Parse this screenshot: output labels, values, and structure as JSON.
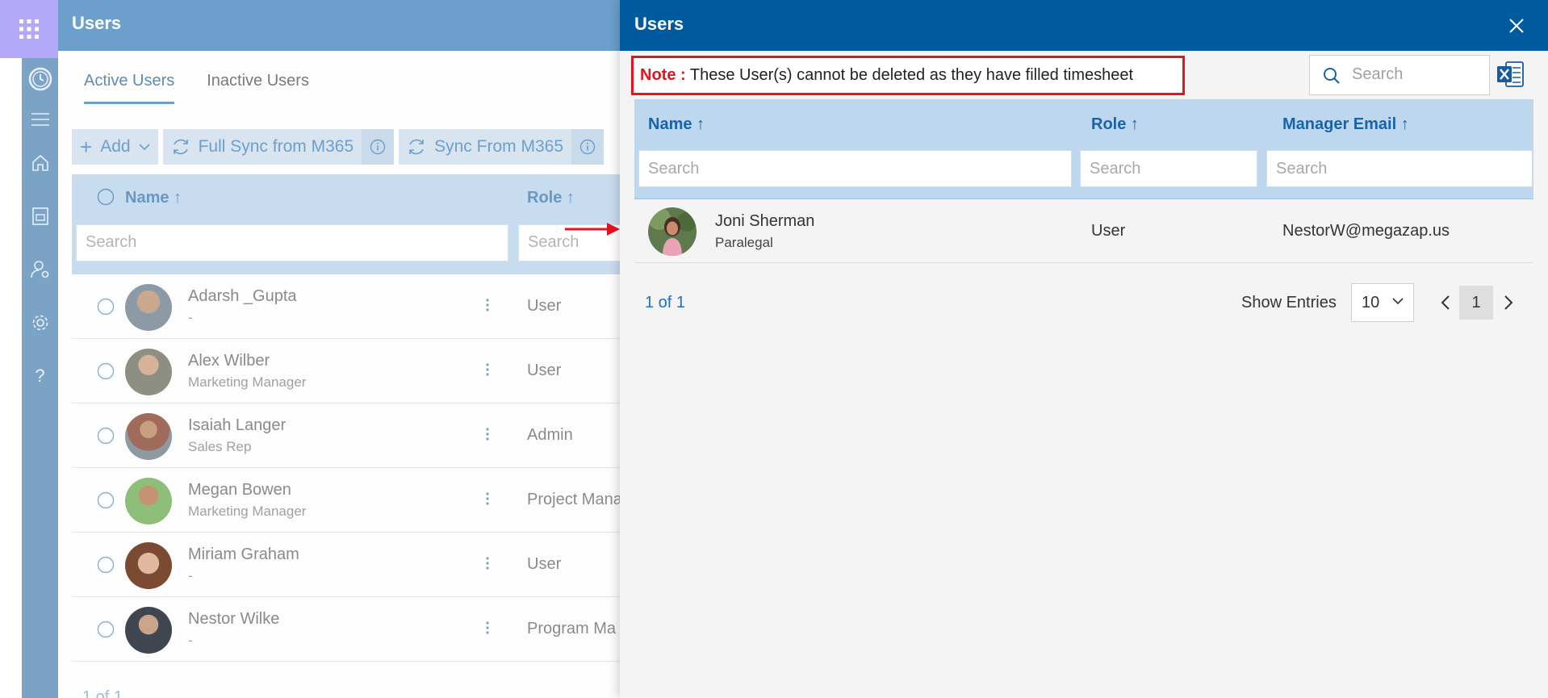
{
  "background": {
    "app_title": "Users",
    "tabs": [
      {
        "label": "Active Users",
        "active": true
      },
      {
        "label": "Inactive Users",
        "active": false
      }
    ],
    "toolbar": {
      "add_label": "Add",
      "full_sync_label": "Full Sync from M365",
      "sync_label": "Sync From M365"
    },
    "table": {
      "columns": {
        "name": "Name ↑",
        "role": "Role ↑"
      },
      "search_placeholder": "Search",
      "rows": [
        {
          "name": "Adarsh _Gupta",
          "subtitle": "-",
          "role": "User"
        },
        {
          "name": "Alex Wilber",
          "subtitle": "Marketing Manager",
          "role": "User"
        },
        {
          "name": "Isaiah Langer",
          "subtitle": "Sales Rep",
          "role": "Admin"
        },
        {
          "name": "Megan Bowen",
          "subtitle": "Marketing Manager",
          "role": "Project Mana"
        },
        {
          "name": "Miriam Graham",
          "subtitle": "-",
          "role": "User"
        },
        {
          "name": "Nestor Wilke",
          "subtitle": "-",
          "role": "Program Ma"
        }
      ],
      "footer": "1 of 1"
    }
  },
  "modal": {
    "title": "Users",
    "note_label": "Note :",
    "note_text": " These User(s) cannot be deleted as they have filled timesheet",
    "search_placeholder": "Search",
    "columns": {
      "name": "Name ↑",
      "role": "Role ↑",
      "manager_email": "Manager Email ↑"
    },
    "filter_placeholders": {
      "name": "Search",
      "role": "Search",
      "manager_email": "Search"
    },
    "rows": [
      {
        "name": "Joni Sherman",
        "subtitle": "Paralegal",
        "role": "User",
        "manager_email": "NestorW@megazap.us"
      }
    ],
    "pagination": {
      "info": "1 of 1",
      "show_entries_label": "Show Entries",
      "entries_value": "10",
      "current_page": "1"
    }
  },
  "colors": {
    "modal_header": "#005a9e",
    "accent_link": "#1a73c0",
    "note_border": "#e5131d",
    "table_header": "#bdd7ee"
  }
}
